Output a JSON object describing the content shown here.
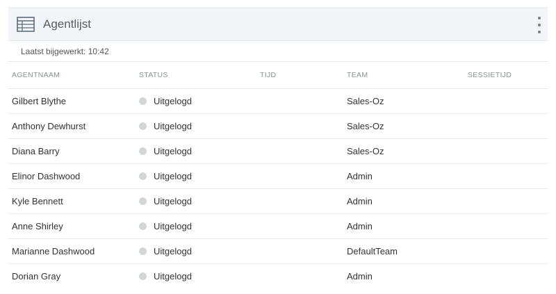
{
  "widget": {
    "title": "Agentlijst",
    "last_updated": "Laatst bijgewerkt: 10:42"
  },
  "icons": {
    "table": "table-icon",
    "menu": "more-vertical-icon"
  },
  "table": {
    "columns": [
      "AGENTNAAM",
      "STATUS",
      "TIJD",
      "TEAM",
      "SESSIETIJD"
    ],
    "rows": [
      {
        "name": "Gilbert Blythe",
        "status": "Uitgelogd",
        "time": "",
        "team": "Sales-Oz",
        "session": ""
      },
      {
        "name": "Anthony Dewhurst",
        "status": "Uitgelogd",
        "time": "",
        "team": "Sales-Oz",
        "session": ""
      },
      {
        "name": "Diana Barry",
        "status": "Uitgelogd",
        "time": "",
        "team": "Sales-Oz",
        "session": ""
      },
      {
        "name": "Elinor Dashwood",
        "status": "Uitgelogd",
        "time": "",
        "team": "Admin",
        "session": ""
      },
      {
        "name": "Kyle Bennett",
        "status": "Uitgelogd",
        "time": "",
        "team": "Admin",
        "session": ""
      },
      {
        "name": "Anne Shirley",
        "status": "Uitgelogd",
        "time": "",
        "team": "Admin",
        "session": ""
      },
      {
        "name": "Marianne Dashwood",
        "status": "Uitgelogd",
        "time": "",
        "team": "DefaultTeam",
        "session": ""
      },
      {
        "name": "Dorian Gray",
        "status": "Uitgelogd",
        "time": "",
        "team": "Admin",
        "session": ""
      }
    ]
  },
  "colors": {
    "status_offline": "#d3d6d8",
    "header_bg": "#f3f6f8"
  }
}
